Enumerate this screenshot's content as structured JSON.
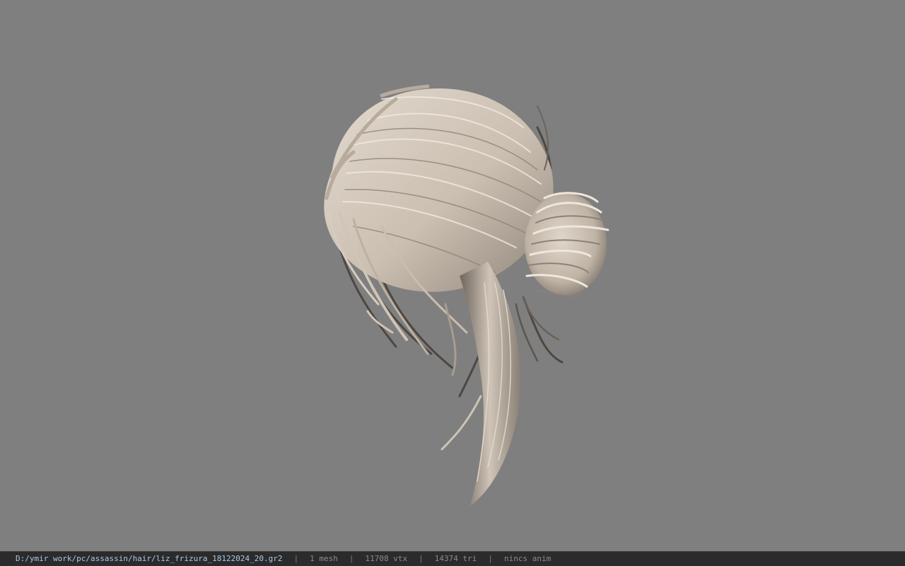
{
  "viewport": {
    "background": "#7f7f7f",
    "model": "hair-mesh",
    "hair_color": "#cfc4b7"
  },
  "status_bar": {
    "file_path": "D:/ymir work/pc/assassin/hair/liz_frizura_18122024_20.gr2",
    "separator": "|",
    "mesh_count": "1 mesh",
    "vertex_count": "11708 vtx",
    "triangle_count": "14374 tri",
    "anim_status": "nincs anim"
  }
}
